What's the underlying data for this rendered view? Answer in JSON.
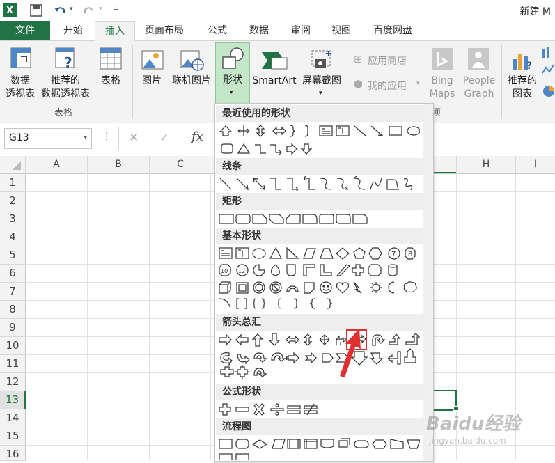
{
  "window": {
    "doc_title": "新建 M"
  },
  "tabs": [
    "文件",
    "开始",
    "插入",
    "页面布局",
    "公式",
    "数据",
    "审阅",
    "视图",
    "百度网盘"
  ],
  "ribbon": {
    "pivot": [
      "数据",
      "透视表"
    ],
    "rec_pivot": [
      "推荐的",
      "数据透视表"
    ],
    "table": "表格",
    "picture": "图片",
    "online_picture": "联机图片",
    "shapes": "形状",
    "smartart": "SmartArt",
    "screenshot": "屏幕截图",
    "app_store": "应用商店",
    "my_apps": "我的应用",
    "bing": [
      "Bing",
      "Maps"
    ],
    "people": [
      "People",
      "Graph"
    ],
    "rec_charts": [
      "推荐的",
      "图表"
    ],
    "group_tables": "表格",
    "group_apps_tail": "项"
  },
  "formula_bar": {
    "namebox": "G13",
    "fx": "fx",
    "cancel": "✕",
    "enter": "✓"
  },
  "grid": {
    "columns": [
      "A",
      "B",
      "C",
      "H",
      "I"
    ],
    "rows": [
      "1",
      "2",
      "3",
      "4",
      "5",
      "6",
      "7",
      "8",
      "9",
      "10",
      "11",
      "12",
      "13",
      "14",
      "15",
      "16"
    ]
  },
  "shapes_menu": {
    "sections": [
      "最近使用的形状",
      "线条",
      "矩形",
      "基本形状",
      "箭头总汇",
      "公式形状",
      "流程图"
    ]
  },
  "watermark": {
    "brand": "Baidu经验",
    "url": "jingyan.baidu.com"
  },
  "colors": {
    "excel_green": "#217346",
    "highlight_red": "#e03030"
  }
}
